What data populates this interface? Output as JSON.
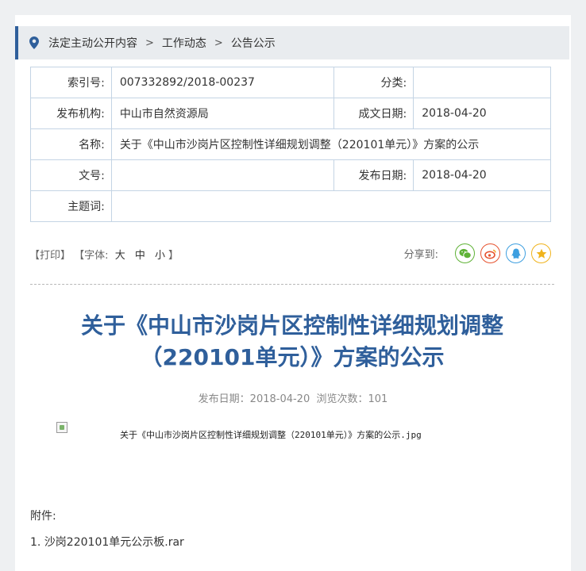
{
  "breadcrumb": {
    "items": [
      "法定主动公开内容",
      "工作动态",
      "公告公示"
    ]
  },
  "meta": {
    "index_label": "索引号:",
    "index_value": "007332892/2018-00237",
    "category_label": "分类:",
    "category_value": "",
    "publisher_label": "发布机构:",
    "publisher_value": "中山市自然资源局",
    "written_date_label": "成文日期:",
    "written_date_value": "2018-04-20",
    "name_label": "名称:",
    "name_value": "关于《中山市沙岗片区控制性详细规划调整（220101单元）》方案的公示",
    "doc_no_label": "文号:",
    "doc_no_value": "",
    "publish_date_label": "发布日期:",
    "publish_date_value": "2018-04-20",
    "keywords_label": "主题词:",
    "keywords_value": ""
  },
  "tools": {
    "print": "【打印】",
    "font_prefix": "【字体:",
    "large": "大",
    "medium": "中",
    "small": "小",
    "font_suffix": "】"
  },
  "share": {
    "label": "分享到:",
    "icons": [
      "wechat-icon",
      "weibo-icon",
      "qq-icon",
      "qzone-icon"
    ],
    "colors": {
      "wechat": "#5fb236",
      "weibo": "#e6532f",
      "qq": "#3d9fe0",
      "qzone": "#f0b31c"
    }
  },
  "article": {
    "title": "关于《中山市沙岗片区控制性详细规划调整（220101单元）》方案的公示",
    "publish_date_text": "发布日期：2018-04-20",
    "views_text": "浏览次数：101",
    "image_alt": "关于《中山市沙岗片区控制性详细规划调整（220101单元）》方案的公示.jpg"
  },
  "attachments": {
    "label": "附件:",
    "items": [
      {
        "number": "1.",
        "name": "沙岗220101单元公示板.rar"
      }
    ]
  },
  "colors": {
    "accent": "#2f5f9b",
    "table_border": "#c4d4e4"
  }
}
